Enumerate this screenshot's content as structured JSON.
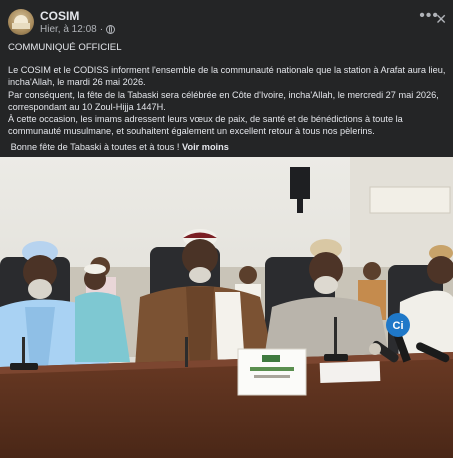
{
  "post": {
    "page_name": "COSIM",
    "timestamp": "Hier, à 12:08",
    "separator": "·",
    "more_icon": "more-horizontal-icon",
    "close_icon": "close-icon",
    "heading": "COMMUNIQUÉ OFFICIEL",
    "paragraph_1": "Le COSIM et le CODISS informent l'ensemble de la communauté nationale que la station à Arafat aura lieu, incha'Allah, le mardi 26 mai 2026.",
    "paragraph_2": "Par conséquent, la fête de la Tabaski sera célébrée en Côte d'Ivoire, incha'Allah, le mercredi 27 mai 2026, correspondant au 10 Zoul-Hijja 1447H.",
    "paragraph_3": "À cette occasion, les imams adressent leurs vœux de paix, de santé et de bénédictions à toute la communauté musulmane, et souhaitent également un excellent retour à tous nos pèlerins.",
    "closing": "Bonne fête de Tabaski à toutes et à tous !",
    "see_more": "Voir moins"
  },
  "photo": {
    "description_icon": "photo-image",
    "mic_brand": "Ci"
  }
}
